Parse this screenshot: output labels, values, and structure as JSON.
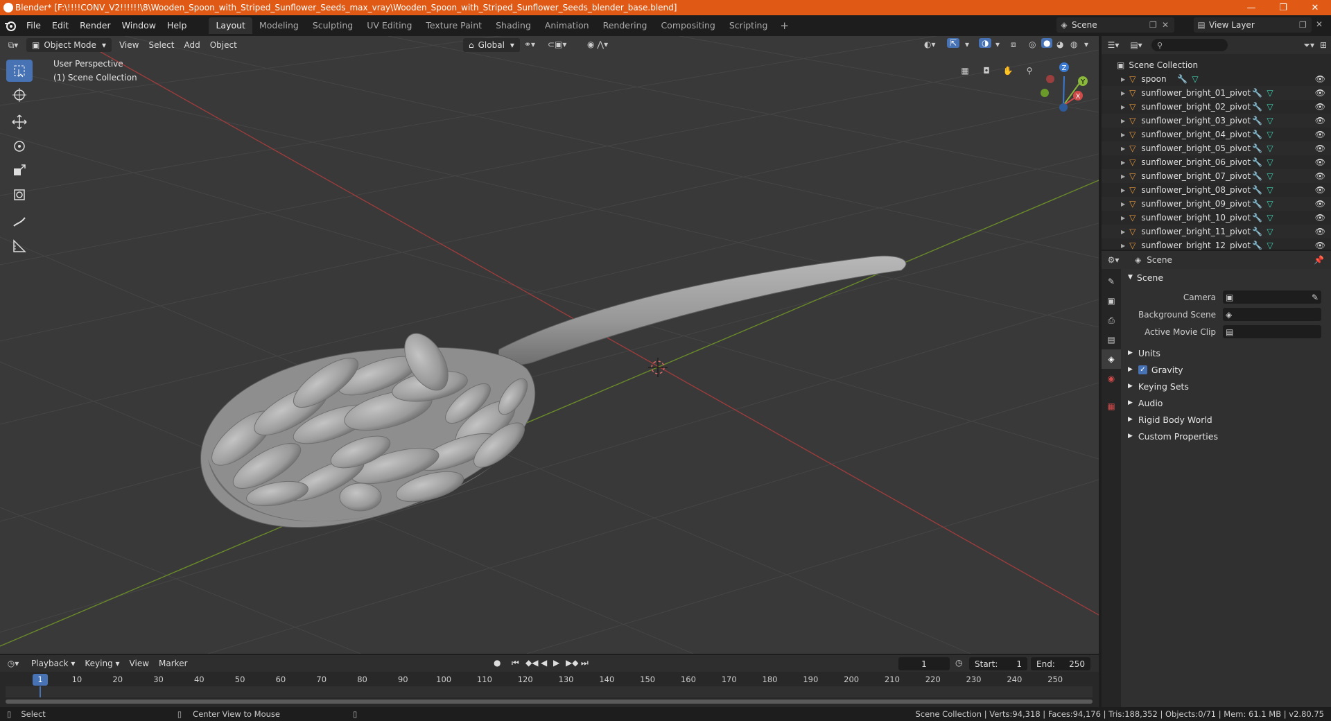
{
  "window": {
    "title": "Blender* [F:\\!!!!CONV_V2!!!!!!\\8\\Wooden_Spoon_with_Striped_Sunflower_Seeds_max_vray\\Wooden_Spoon_with_Striped_Sunflower_Seeds_blender_base.blend]",
    "controls": {
      "minimize": "—",
      "maximize": "❐",
      "close": "✕"
    },
    "accent": "#e05a16"
  },
  "menu": [
    "File",
    "Edit",
    "Render",
    "Window",
    "Help"
  ],
  "workspaces": [
    {
      "label": "Layout",
      "active": true
    },
    {
      "label": "Modeling",
      "active": false
    },
    {
      "label": "Sculpting",
      "active": false
    },
    {
      "label": "UV Editing",
      "active": false
    },
    {
      "label": "Texture Paint",
      "active": false
    },
    {
      "label": "Shading",
      "active": false
    },
    {
      "label": "Animation",
      "active": false
    },
    {
      "label": "Rendering",
      "active": false
    },
    {
      "label": "Compositing",
      "active": false
    },
    {
      "label": "Scripting",
      "active": false
    }
  ],
  "add_workspace": "+",
  "scene_selector": "Scene",
  "view_layer": "View Layer",
  "viewport": {
    "mode": "Object Mode",
    "menus": [
      "View",
      "Select",
      "Add",
      "Object"
    ],
    "orientation": "Global",
    "info_line1": "User Perspective",
    "info_line2": "(1) Scene Collection",
    "gizmo": {
      "z": "Z",
      "y": "Y",
      "x": "X"
    }
  },
  "outliner": {
    "root": "Scene Collection",
    "items": [
      "spoon",
      "sunflower_bright_01_pivot",
      "sunflower_bright_02_pivot",
      "sunflower_bright_03_pivot",
      "sunflower_bright_04_pivot",
      "sunflower_bright_05_pivot",
      "sunflower_bright_06_pivot",
      "sunflower_bright_07_pivot",
      "sunflower_bright_08_pivot",
      "sunflower_bright_09_pivot",
      "sunflower_bright_10_pivot",
      "sunflower_bright_11_pivot",
      "sunflower_bright_12_pivot"
    ]
  },
  "properties": {
    "context": "Scene",
    "panel": "Scene",
    "fields": [
      {
        "label": "Camera"
      },
      {
        "label": "Background Scene"
      },
      {
        "label": "Active Movie Clip"
      }
    ],
    "subpanels": [
      "Units",
      "Gravity",
      "Keying Sets",
      "Audio",
      "Rigid Body World",
      "Custom Properties"
    ]
  },
  "timeline": {
    "menus": [
      "Playback",
      "Keying",
      "View",
      "Marker"
    ],
    "current_frame": "1",
    "start_label": "Start:",
    "start": "1",
    "end_label": "End:",
    "end": "250",
    "ruler_current": "1",
    "ticks": [
      "10",
      "20",
      "30",
      "40",
      "50",
      "60",
      "70",
      "80",
      "90",
      "100",
      "110",
      "120",
      "130",
      "140",
      "150",
      "160",
      "170",
      "180",
      "190",
      "200",
      "210",
      "220",
      "230",
      "240",
      "250"
    ]
  },
  "status": {
    "left": "Select",
    "middle": "Center View to Mouse",
    "right": "Scene Collection | Verts:94,318 | Faces:94,176 | Tris:188,352 | Objects:0/71 | Mem: 61.1 MB | v2.80.75"
  }
}
